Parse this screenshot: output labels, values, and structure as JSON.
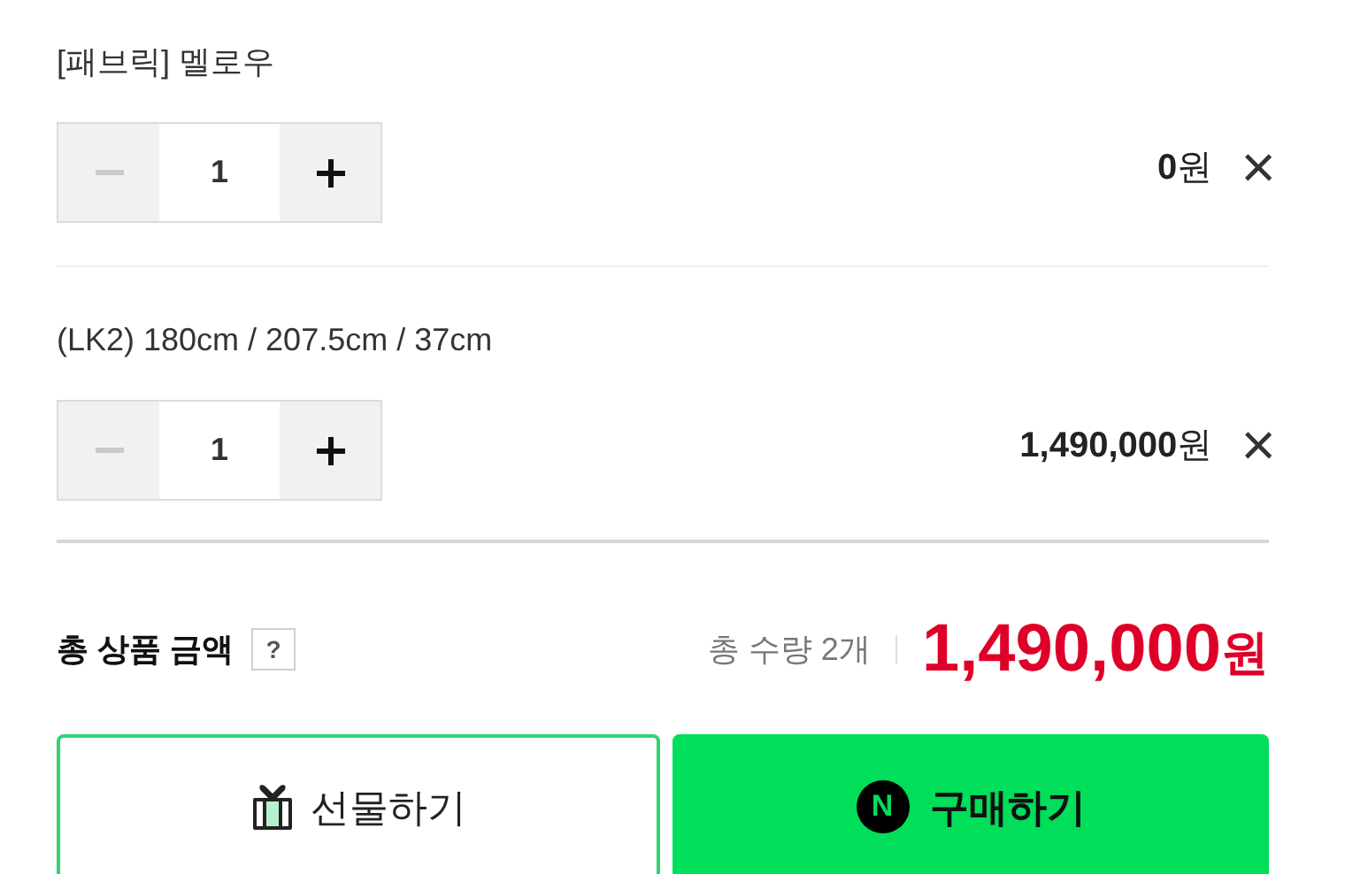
{
  "options": [
    {
      "name": "[패브릭] 멜로우",
      "quantity": "1",
      "minus_disabled": true,
      "plus_disabled": false,
      "price": "**0**원",
      "remove": "×"
    },
    {
      "name": "(LK2) 180cm / 207.5cm / 37cm",
      "quantity": "1",
      "minus_disabled": true,
      "plus_disabled": false,
      "price": "**1,490,000**원",
      "remove": "×"
    }
  ],
  "total": {
    "label": "총 상품 금액",
    "help": "?",
    "quantity": "총 수량 2개",
    "amount": "1,490,000",
    "currency": "원"
  },
  "buttons": [
    {
      "kind": "gift",
      "label": "선물하기"
    },
    {
      "kind": "buy",
      "mark": "N",
      "label": "구매하기"
    }
  ]
}
